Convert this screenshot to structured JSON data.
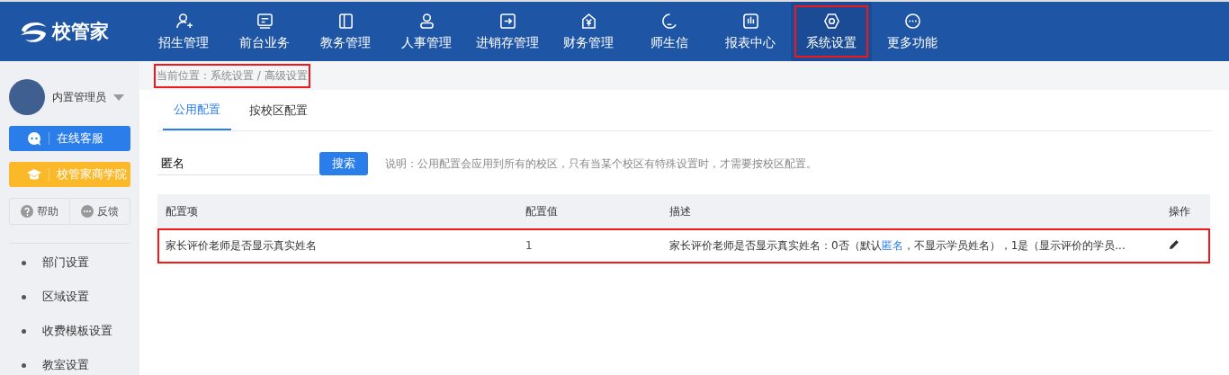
{
  "brand": {
    "name": "校管家"
  },
  "nav": [
    {
      "label": "招生管理",
      "selected": false,
      "highlighted": false
    },
    {
      "label": "前台业务",
      "selected": false,
      "highlighted": false
    },
    {
      "label": "教务管理",
      "selected": false,
      "highlighted": false
    },
    {
      "label": "人事管理",
      "selected": false,
      "highlighted": false
    },
    {
      "label": "进销存管理",
      "selected": false,
      "highlighted": false
    },
    {
      "label": "财务管理",
      "selected": false,
      "highlighted": false
    },
    {
      "label": "师生信",
      "selected": false,
      "highlighted": false
    },
    {
      "label": "报表中心",
      "selected": false,
      "highlighted": false
    },
    {
      "label": "系统设置",
      "selected": true,
      "highlighted": true
    },
    {
      "label": "更多功能",
      "selected": false,
      "highlighted": false
    }
  ],
  "sidebar": {
    "user": "内置管理员",
    "buttons": [
      {
        "label": "在线客服",
        "kind": "service"
      },
      {
        "label": "校管家商学院",
        "kind": "academy"
      }
    ],
    "links": [
      "帮助",
      "反馈"
    ],
    "items": [
      {
        "label": "部门设置"
      },
      {
        "label": "区域设置"
      },
      {
        "label": "收费模板设置"
      },
      {
        "label": "教室设置"
      }
    ]
  },
  "breadcrumb": {
    "text": "当前位置：系统设置 / 高级设置",
    "highlighted": true
  },
  "tabs": [
    {
      "label": "公用配置",
      "selected": true
    },
    {
      "label": "按校区配置",
      "selected": false
    }
  ],
  "search": {
    "value": "匿名",
    "button": "搜索",
    "note": "说明：公用配置会应用到所有的校区，只有当某个校区有特殊设置时，才需要按校区配置。"
  },
  "table": {
    "columns": [
      "配置项",
      "配置值",
      "描述",
      "操作"
    ],
    "rows": [
      {
        "name": "家长评价老师是否显示真实姓名",
        "value": "1",
        "description": {
          "before": "家长评价老师是否显示真实姓名：0否（默认",
          "match": "匿名",
          "after": "，不显示学员姓名），1是（显示评价的学员..."
        },
        "highlighted": true
      }
    ]
  }
}
